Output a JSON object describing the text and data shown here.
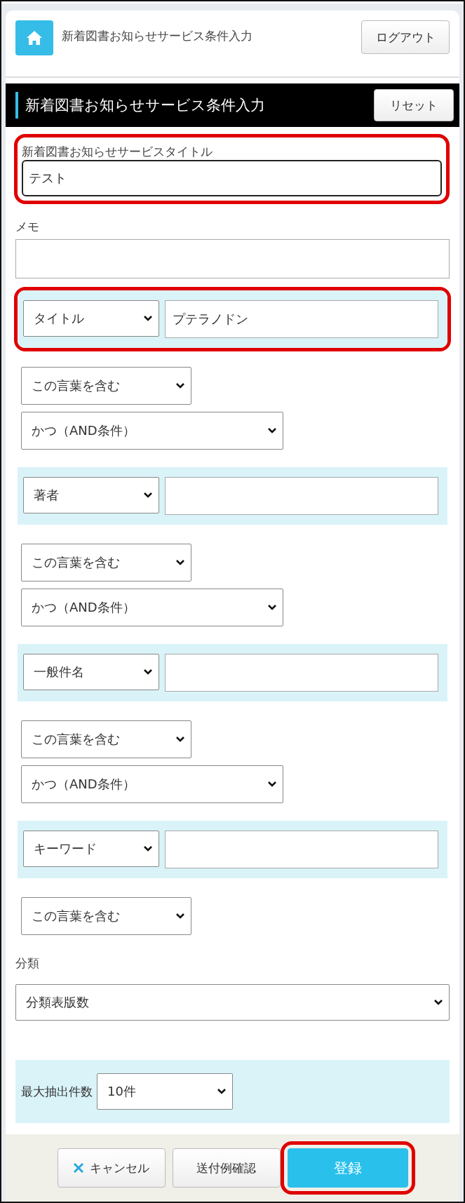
{
  "header": {
    "title": "新着図書お知らせサービス条件入力",
    "logout_button": "ログアウト"
  },
  "section": {
    "title": "新着図書お知らせサービス条件入力",
    "reset_button": "リセット"
  },
  "service_title": {
    "label": "新着図書お知らせサービスタイトル",
    "value": "テスト",
    "focused": true,
    "highlighted": true
  },
  "memo": {
    "label": "メモ"
  },
  "criteria": [
    {
      "field": "タイトル",
      "value": "プテラノドン",
      "highlighted": true,
      "match": "この言葉を含む",
      "conjunction": "かつ（AND条件）"
    },
    {
      "field": "著者",
      "highlighted": false,
      "match": "この言葉を含む",
      "conjunction": "かつ（AND条件）"
    },
    {
      "field": "一般件名",
      "highlighted": false,
      "match": "この言葉を含む",
      "conjunction": "かつ（AND条件）"
    },
    {
      "field": "キーワード",
      "highlighted": false,
      "match": "この言葉を含む"
    }
  ],
  "classification": {
    "label": "分類",
    "value": "分類表版数"
  },
  "max_results": {
    "label": "最大抽出件数",
    "value": "10件"
  },
  "footer_buttons": [
    {
      "label": "キャンセル",
      "kind": "cancel",
      "highlighted": false
    },
    {
      "label": "送付例確認",
      "kind": "secondary",
      "highlighted": false
    },
    {
      "label": "登録",
      "kind": "primary",
      "highlighted": true
    }
  ]
}
